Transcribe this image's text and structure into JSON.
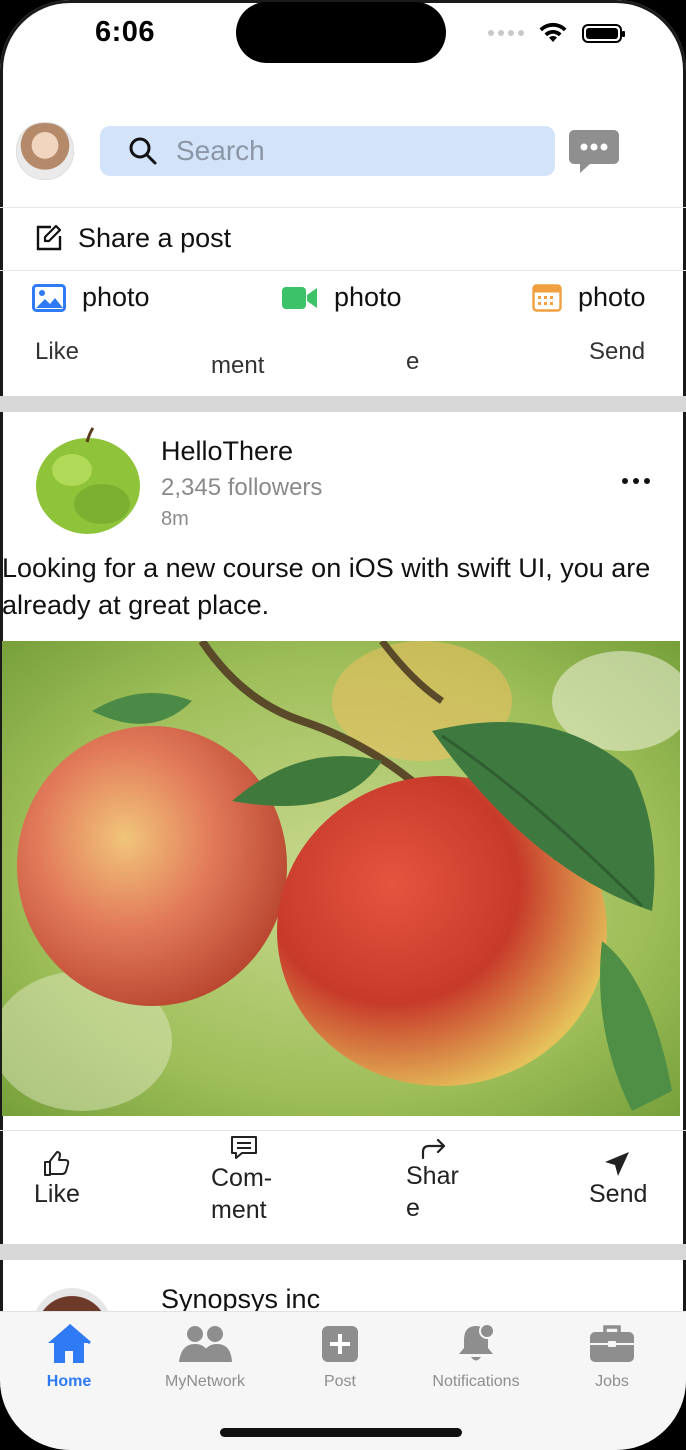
{
  "status_bar": {
    "time": "6:06"
  },
  "header": {
    "search_placeholder": "Search"
  },
  "composer": {
    "share_label": "Share a post",
    "media": [
      {
        "label": "photo",
        "icon": "image-icon",
        "color": "#2f7bf5"
      },
      {
        "label": "photo",
        "icon": "video-icon",
        "color": "#3cc36a"
      },
      {
        "label": "photo",
        "icon": "calendar-icon",
        "color": "#f0a040"
      }
    ]
  },
  "clipped_actions": [
    "Like",
    "ment",
    "e",
    "Send"
  ],
  "post": {
    "author": "HelloThere",
    "followers": "2,345 followers",
    "time": "8m",
    "text": "Looking for a new course on iOS with swift UI, you are already at great place."
  },
  "actions": {
    "like": "Like",
    "comment_1": "Com-",
    "comment_2": "ment",
    "share_1": "Shar",
    "share_2": "e",
    "send": "Send"
  },
  "next_post": {
    "author": "Synopsys inc"
  },
  "tabs": [
    {
      "label": "Home",
      "active": true
    },
    {
      "label": "MyNetwork",
      "active": false
    },
    {
      "label": "Post",
      "active": false
    },
    {
      "label": "Notifications",
      "active": false
    },
    {
      "label": "Jobs",
      "active": false
    }
  ],
  "colors": {
    "accent": "#2f7bf5",
    "search_bg": "#d2e3fa",
    "tab_inactive": "#8e8e8e"
  }
}
